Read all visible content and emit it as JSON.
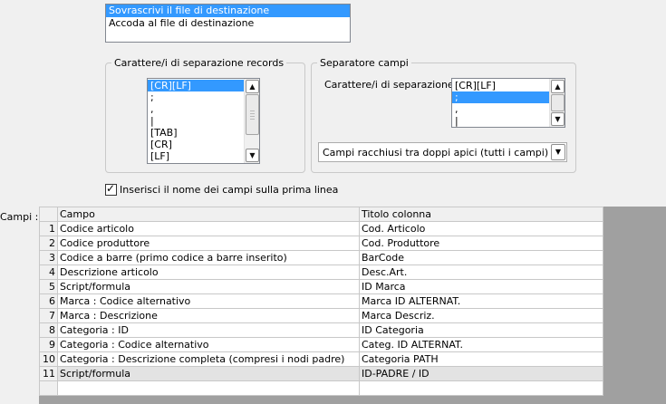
{
  "write_mode": {
    "items": [
      {
        "label": "Sovrascrivi il file di destinazione",
        "selected": true
      },
      {
        "label": "Accoda al file di destinazione",
        "selected": false
      }
    ]
  },
  "record_sep": {
    "title": "Carattere/i di separazione records",
    "items": [
      "[CR][LF]",
      ";",
      ",",
      "|",
      "[TAB]",
      "[CR]",
      "[LF]"
    ],
    "selected_index": 0
  },
  "field_sep": {
    "title": "Separatore campi",
    "label": "Carattere/i di separazione :",
    "items": [
      "[CR][LF]",
      ";",
      ",",
      "|"
    ],
    "selected_index": 1,
    "quote_combo": "Campi racchiusi tra doppi apici (tutti i campi)"
  },
  "header_checkbox": {
    "label": "Inserisci il nome dei campi sulla prima linea",
    "checked": true
  },
  "fields_label": "Campi :",
  "grid": {
    "columns": [
      "Campo",
      "Titolo colonna"
    ],
    "rows": [
      {
        "n": "1",
        "campo": "Codice articolo",
        "titolo": "Cod. Articolo"
      },
      {
        "n": "2",
        "campo": "Codice produttore",
        "titolo": "Cod. Produttore"
      },
      {
        "n": "3",
        "campo": "Codice a barre (primo codice a barre inserito)",
        "titolo": "BarCode"
      },
      {
        "n": "4",
        "campo": "Descrizione articolo",
        "titolo": "Desc.Art."
      },
      {
        "n": "5",
        "campo": "Script/formula",
        "titolo": "ID Marca"
      },
      {
        "n": "6",
        "campo": "Marca : Codice alternativo",
        "titolo": "Marca ID ALTERNAT."
      },
      {
        "n": "7",
        "campo": "Marca : Descrizione",
        "titolo": "Marca Descriz."
      },
      {
        "n": "8",
        "campo": "Categoria : ID",
        "titolo": "ID Categoria"
      },
      {
        "n": "9",
        "campo": "Categoria : Codice alternativo",
        "titolo": "Categ. ID ALTERNAT."
      },
      {
        "n": "10",
        "campo": "Categoria : Descrizione completa (compresi i nodi padre)",
        "titolo": "Categoria PATH"
      },
      {
        "n": "11",
        "campo": "Script/formula",
        "titolo": "ID-PADRE / ID"
      },
      {
        "n": "",
        "campo": "",
        "titolo": ""
      }
    ],
    "current_row": 10
  },
  "icons": {
    "scroll_up": "chevron-up-icon",
    "scroll_down": "chevron-down-icon",
    "combo_dropdown": "chevron-down-icon",
    "check": "checkmark-icon"
  },
  "colors": {
    "selection": "#3399ff",
    "window_bg": "#f0f0f0",
    "grid_bg": "#a0a0a0"
  }
}
